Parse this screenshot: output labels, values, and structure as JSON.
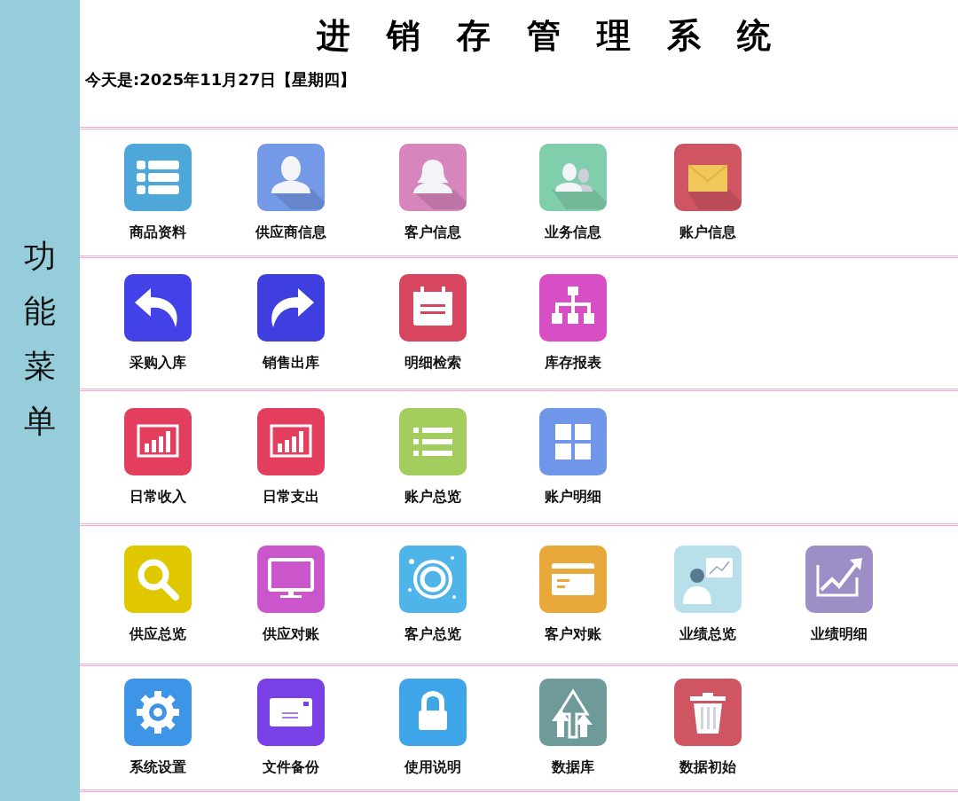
{
  "sidebar": {
    "title": "功能菜单"
  },
  "header": {
    "title": "进销存管理系统",
    "date": "今天是:2025年11月27日【星期四】"
  },
  "sections": [
    {
      "items": [
        {
          "label": "商品资料",
          "kind": "list",
          "color": "#4ea7d9"
        },
        {
          "label": "供应商信息",
          "kind": "person",
          "color": "#7499e6"
        },
        {
          "label": "客户信息",
          "kind": "woman",
          "color": "#d686bc"
        },
        {
          "label": "业务信息",
          "kind": "people",
          "color": "#80ceab"
        },
        {
          "label": "账户信息",
          "kind": "mail",
          "color": "#d05563"
        }
      ]
    },
    {
      "items": [
        {
          "label": "采购入库",
          "kind": "undo",
          "color": "#4341e8"
        },
        {
          "label": "销售出库",
          "kind": "redo",
          "color": "#3f3fe0"
        },
        {
          "label": "明细检索",
          "kind": "calendar",
          "color": "#d7465e"
        },
        {
          "label": "库存报表",
          "kind": "org",
          "color": "#d84ec4"
        }
      ]
    },
    {
      "items": [
        {
          "label": "日常收入",
          "kind": "chart",
          "color": "#e43e5f"
        },
        {
          "label": "日常支出",
          "kind": "chart",
          "color": "#e43e5f"
        },
        {
          "label": "账户总览",
          "kind": "bullets",
          "color": "#a3cd5c"
        },
        {
          "label": "账户明细",
          "kind": "grid",
          "color": "#6f96e8"
        }
      ]
    },
    {
      "items": [
        {
          "label": "供应总览",
          "kind": "search",
          "color": "#e0c800"
        },
        {
          "label": "供应对账",
          "kind": "monitor",
          "color": "#cb56cc"
        },
        {
          "label": "客户总览",
          "kind": "lifebuoy",
          "color": "#4fb5e8"
        },
        {
          "label": "客户对账",
          "kind": "card",
          "color": "#e8a83a"
        },
        {
          "label": "业绩总览",
          "kind": "presenter",
          "color": "#b7e0ea"
        },
        {
          "label": "业绩明细",
          "kind": "trend",
          "color": "#9d8fc6"
        }
      ]
    },
    {
      "items": [
        {
          "label": "系统设置",
          "kind": "gear",
          "color": "#3e95e8"
        },
        {
          "label": "文件备份",
          "kind": "envelope",
          "color": "#7a40e8"
        },
        {
          "label": "使用说明",
          "kind": "lock",
          "color": "#3ea6e8"
        },
        {
          "label": "数据库",
          "kind": "arrows",
          "color": "#6f9a9a"
        },
        {
          "label": "数据初始",
          "kind": "trash",
          "color": "#d05563"
        }
      ]
    }
  ]
}
